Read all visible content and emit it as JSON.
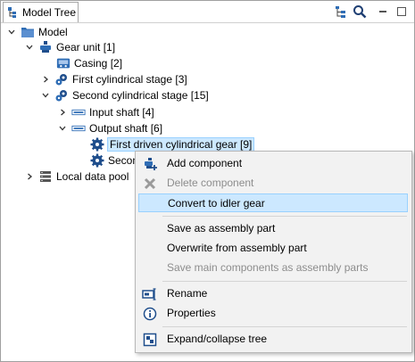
{
  "tab": {
    "label": "Model Tree"
  },
  "toolbar": {
    "tree_options_icon": "tree-options-icon",
    "search_icon": "search-icon",
    "minimize_icon": "minimize-icon",
    "maximize_icon": "maximize-icon"
  },
  "tree": {
    "model": "Model",
    "gear_unit": "Gear unit [1]",
    "casing": "Casing [2]",
    "first_stage": "First cylindrical stage [3]",
    "second_stage": "Second cylindrical stage [15]",
    "input_shaft": "Input shaft [4]",
    "output_shaft": "Output shaft [6]",
    "first_driven_gear": "First driven cylindrical gear [9]",
    "second_truncated": "Secon",
    "local_data_pool": "Local data pool"
  },
  "context_menu": {
    "items": [
      {
        "label": "Add component",
        "icon": "add-component-icon",
        "enabled": true
      },
      {
        "label": "Delete component",
        "icon": "delete-icon",
        "enabled": false
      },
      {
        "label": "Convert to idler gear",
        "icon": "",
        "enabled": true,
        "highlighted": true
      },
      {
        "label": "Save as assembly part",
        "icon": "",
        "enabled": true
      },
      {
        "label": "Overwrite from assembly part",
        "icon": "",
        "enabled": true
      },
      {
        "label": "Save main components as assembly parts",
        "icon": "",
        "enabled": false
      },
      {
        "label": "Rename",
        "icon": "rename-icon",
        "enabled": true
      },
      {
        "label": "Properties",
        "icon": "info-icon",
        "enabled": true
      },
      {
        "label": "Expand/collapse tree",
        "icon": "expand-collapse-icon",
        "enabled": true
      }
    ]
  },
  "colors": {
    "selection": "#cce8ff",
    "selection_border": "#99d1ff",
    "menu_bg": "#f2f2f2",
    "icon_blue": "#1f4e8c",
    "disabled_text": "#8d8d8d"
  }
}
